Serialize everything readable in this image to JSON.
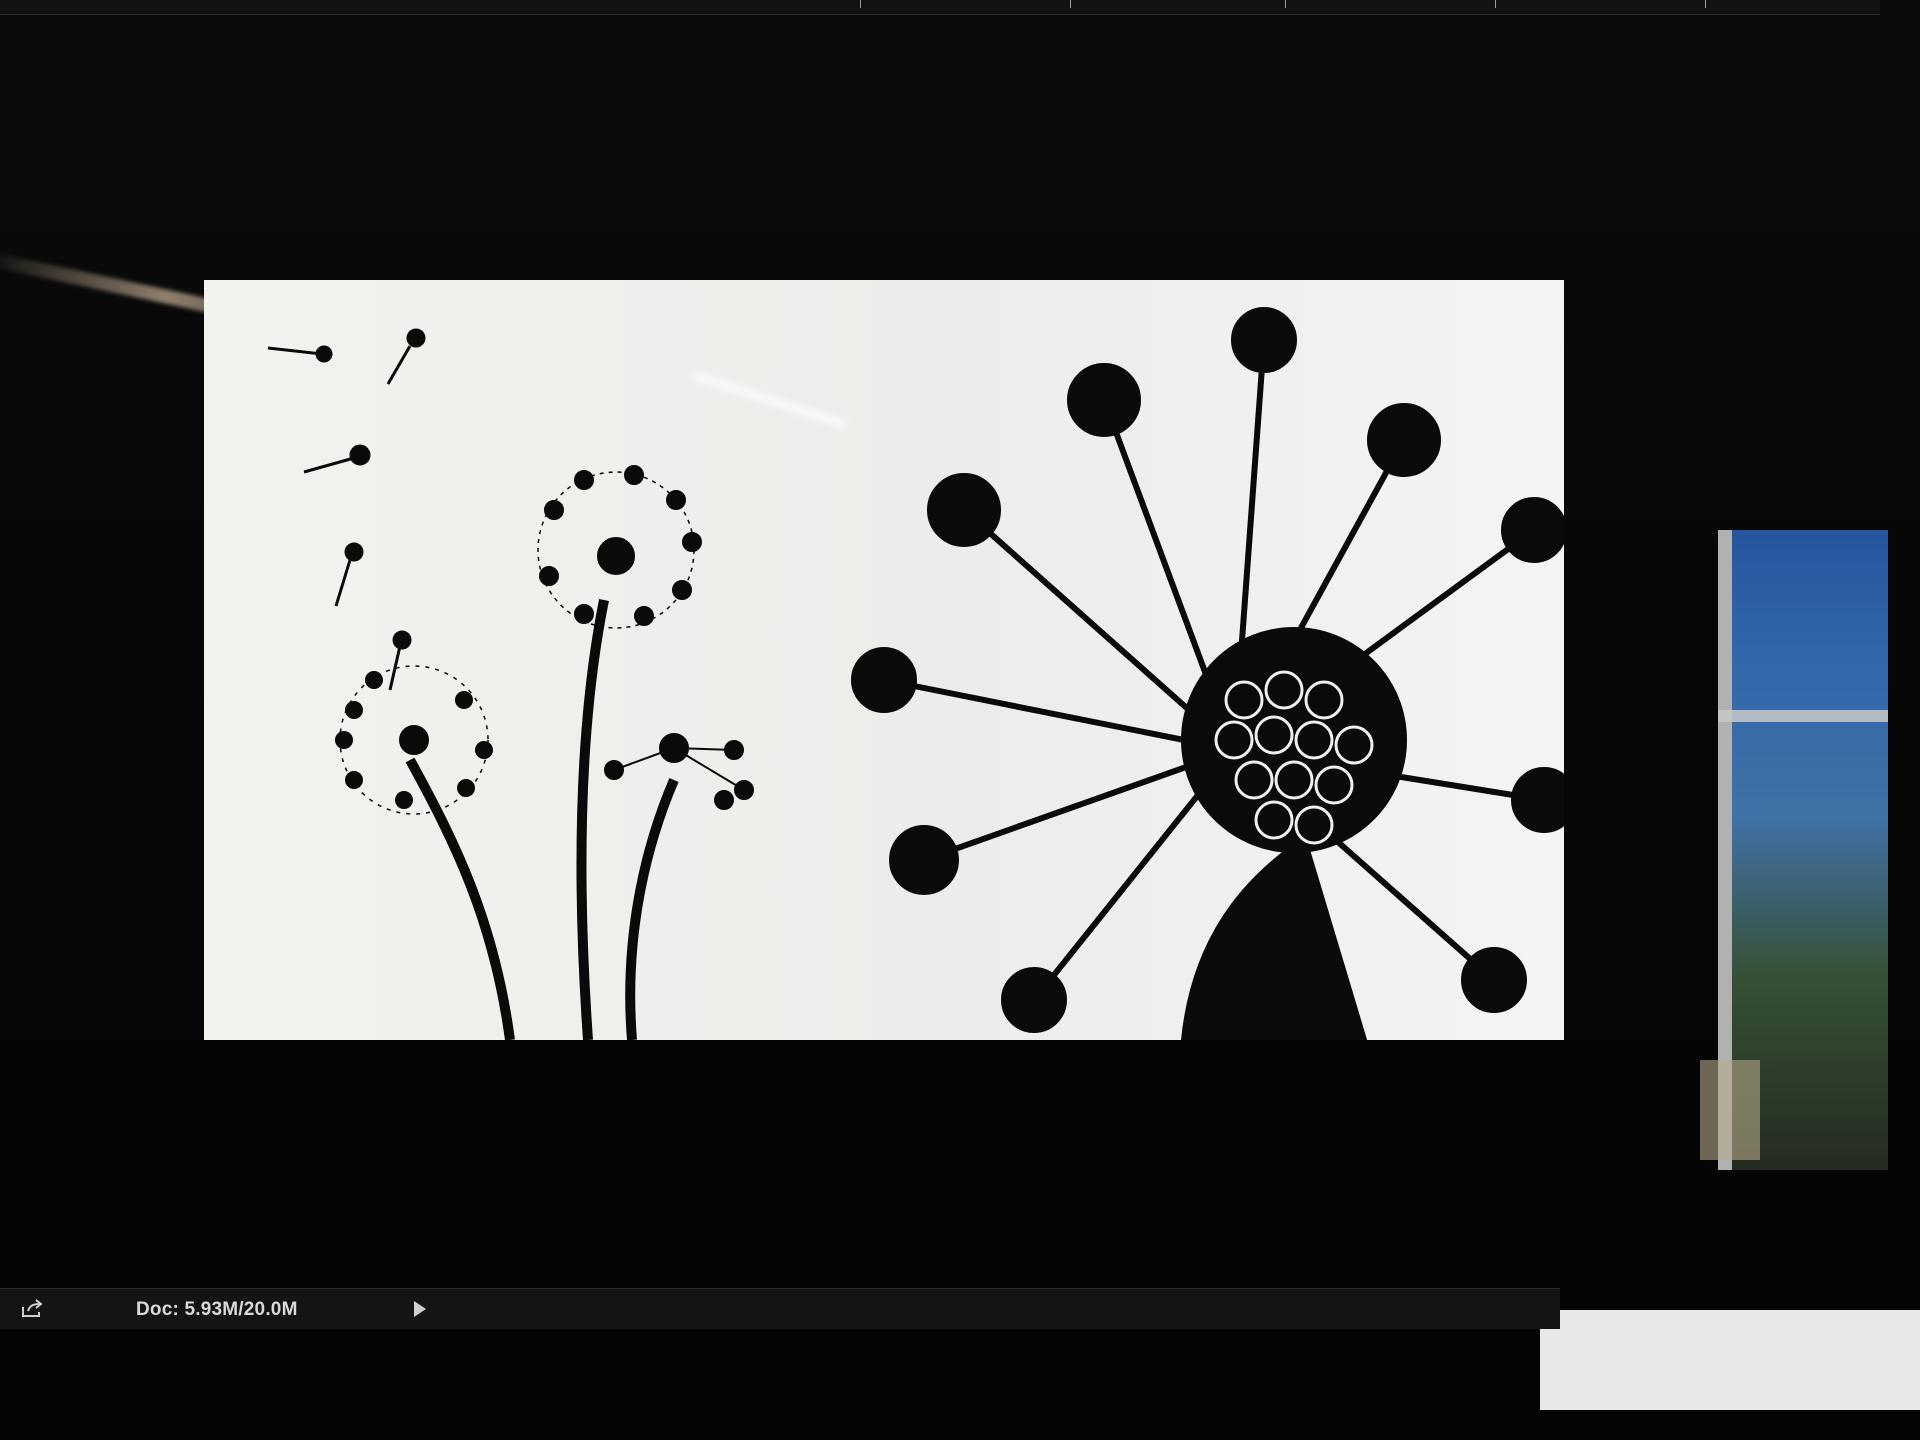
{
  "status_bar": {
    "doc_info": "Doc: 5.93M/20.0M",
    "share_icon": "share-icon",
    "menu_arrow_icon": "play-arrow-icon"
  },
  "canvas": {
    "content": "dandelion-silhouette-artwork",
    "background_color": "#efefec",
    "ink_color": "#0a0a0a"
  },
  "colors": {
    "app_background": "#050505",
    "status_bar": "#141414",
    "status_text": "#d9d9d9"
  }
}
